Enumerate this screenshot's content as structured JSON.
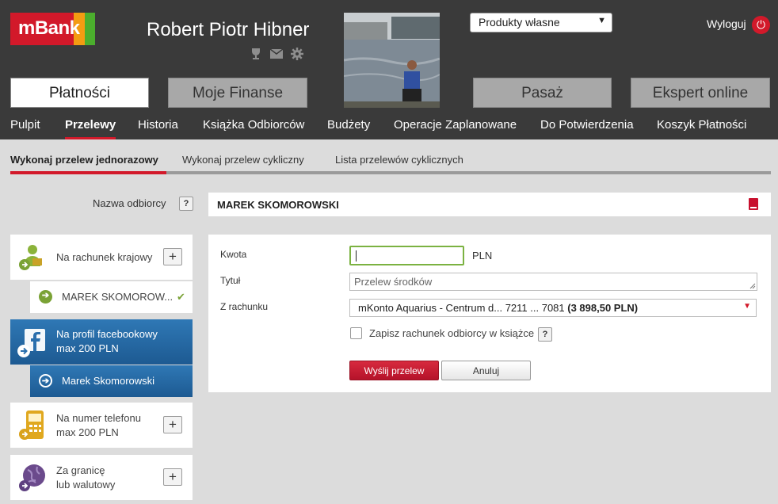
{
  "header": {
    "logo_text": "mBank",
    "user_name": "Robert Piotr Hibner",
    "product_select": "Produkty własne",
    "logout_label": "Wyloguj",
    "big_tabs": [
      "Płatności",
      "Moje Finanse",
      "Pasaż",
      "Ekspert online"
    ],
    "nav": [
      "Pulpit",
      "Przelewy",
      "Historia",
      "Książka Odbiorców",
      "Budżety",
      "Operacje Zaplanowane",
      "Do Potwierdzenia",
      "Koszyk Płatności"
    ],
    "active_nav": "Przelewy"
  },
  "subtabs": [
    "Wykonaj przelew jednorazowy",
    "Wykonaj przelew cykliczny",
    "Lista przelewów cyklicznych"
  ],
  "recipient": {
    "label": "Nazwa odbiorcy",
    "help": "?",
    "value": "MAREK SKOMOROWSKI"
  },
  "sidebar": {
    "domestic": {
      "label": "Na rachunek krajowy",
      "sub": "MAREK SKOMOROW..."
    },
    "facebook": {
      "line1": "Na profil facebookowy",
      "line2": "max 200 PLN",
      "sub": "Marek Skomorowski"
    },
    "phone": {
      "line1": "Na numer telefonu",
      "line2": "max 200 PLN"
    },
    "abroad": {
      "line1": "Za granicę",
      "line2": "lub walutowy"
    },
    "plus": "+"
  },
  "form": {
    "amount_label": "Kwota",
    "amount_value": "",
    "currency": "PLN",
    "title_label": "Tytuł",
    "title_placeholder": "Przelew środków",
    "account_label": "Z rachunku",
    "account_value": "mKonto Aquarius - Centrum d... 7211 ... 7081",
    "account_balance": "(3 898,50 PLN)",
    "save_label": "Zapisz rachunek odbiorcy w książce",
    "help": "?",
    "send_label": "Wyślij przelew",
    "cancel_label": "Anuluj"
  },
  "colors": {
    "brand_red": "#d2192a",
    "accent_blue": "#2a6fad",
    "active_green": "#7bb241"
  }
}
